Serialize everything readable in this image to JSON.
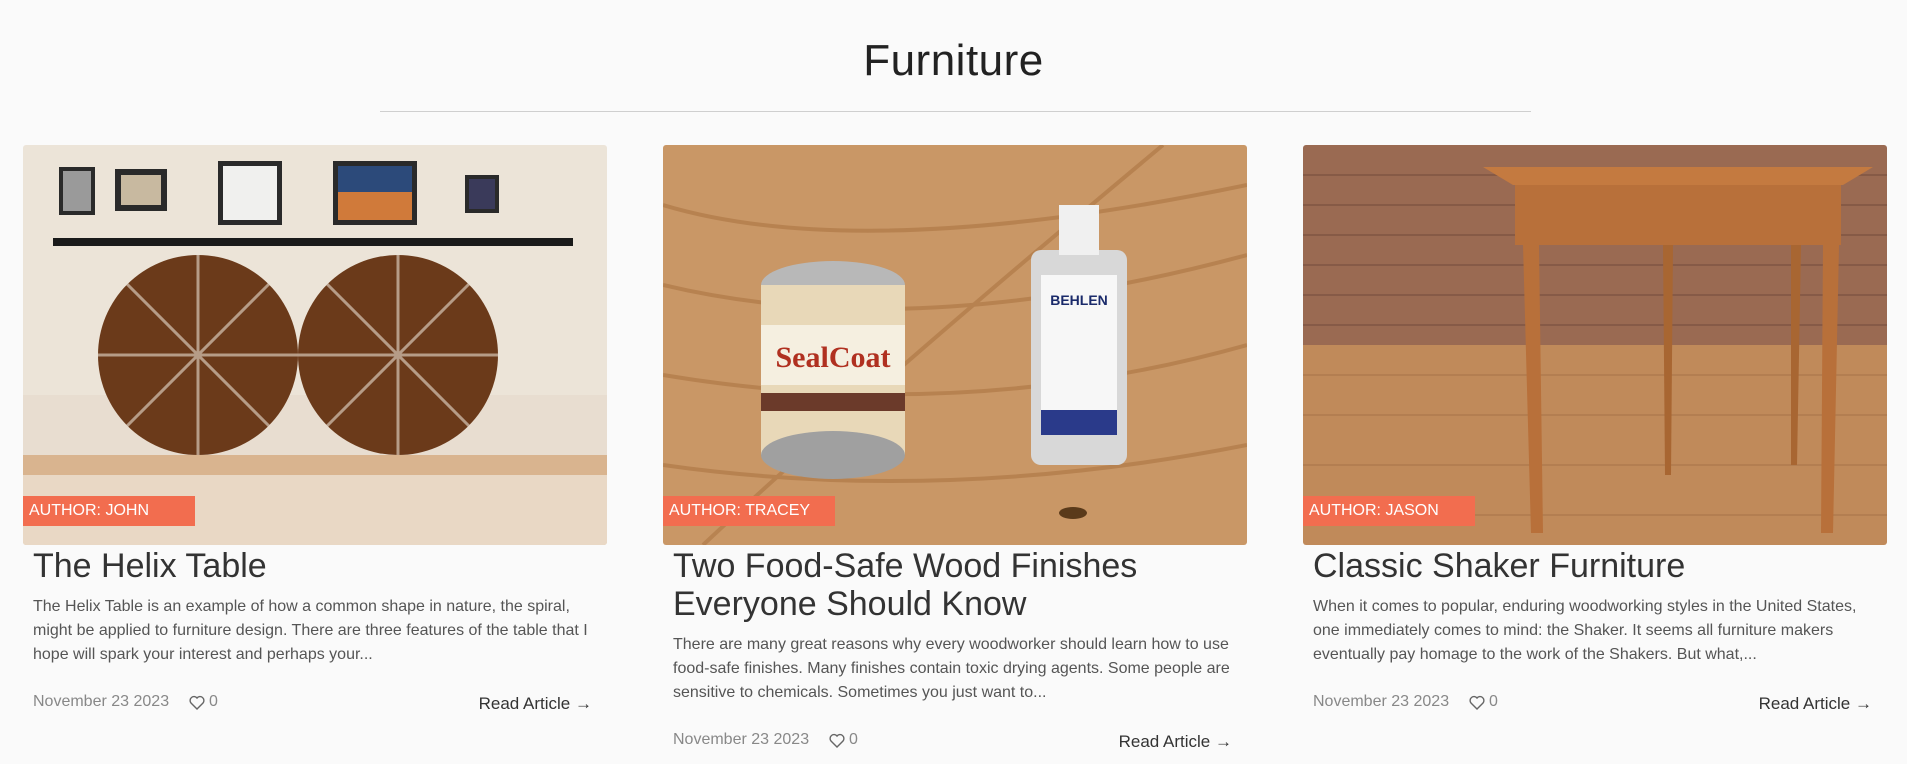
{
  "section": {
    "title": "Furniture"
  },
  "articles": [
    {
      "author": "AUTHOR: JOHN",
      "title": "The Helix Table",
      "excerpt": "The Helix Table is an example of how a common shape in nature, the spiral, might be applied to furniture design. There are three features of the table that I hope will spark your interest and perhaps your...",
      "date": "November 23 2023",
      "likes": "0",
      "read_label": "Read Article →"
    },
    {
      "author": "AUTHOR: TRACEY",
      "title": "Two Food-Safe Wood Finishes Everyone Should Know",
      "excerpt": "There are many great reasons why every woodworker should learn how to use food-safe finishes. Many finishes contain toxic drying agents. Some people are sensitive to chemicals. Sometimes you just want to...",
      "date": "November 23 2023",
      "likes": "0",
      "read_label": "Read Article →"
    },
    {
      "author": "AUTHOR: JASON",
      "title": "Classic Shaker Furniture",
      "excerpt": "When it comes to popular, enduring woodworking styles in the United States, one immediately comes to mind: the Shaker. It seems all furniture makers eventually pay homage to the work of the Shakers. But what,...",
      "date": "November 23 2023",
      "likes": "0",
      "read_label": "Read Article →"
    }
  ],
  "colors": {
    "badge": "#f26d4f",
    "background": "#fafafa"
  },
  "icons": {
    "like": "heart-outline-icon",
    "arrow": "right-arrow"
  }
}
